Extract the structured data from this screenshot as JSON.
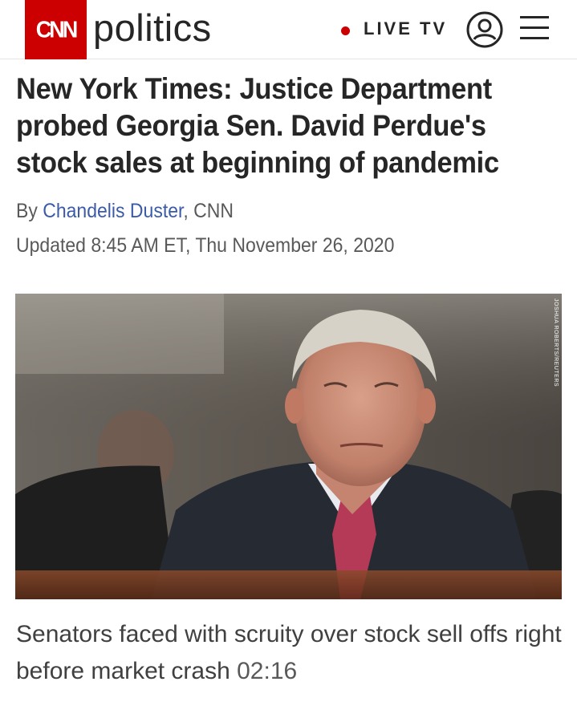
{
  "header": {
    "logo_text": "CNN",
    "section": "politics",
    "live_tv_label": "LIVE TV",
    "brand_color": "#cc0000",
    "icons": [
      "user-account-icon",
      "hamburger-menu-icon"
    ]
  },
  "article": {
    "headline": "New York Times: Justice Department probed Georgia Sen. David Perdue's stock sales at beginning of pandemic",
    "byline_prefix": "By ",
    "author": "Chandelis Duster",
    "byline_suffix": ", CNN",
    "updated": "Updated 8:45 AM ET, Thu November 26, 2020",
    "photo_credit": "JOSHUA ROBERTS/REUTERS"
  },
  "video": {
    "caption": "Senators faced with scruity over stock sell offs right before market crash",
    "duration": "02:16"
  }
}
